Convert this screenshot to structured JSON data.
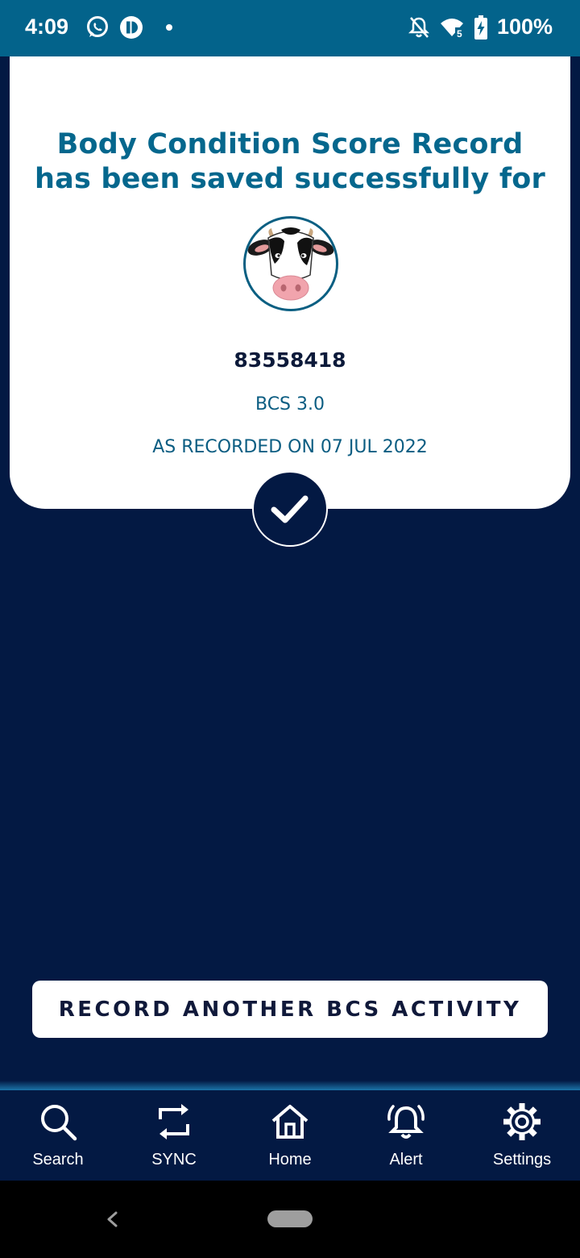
{
  "status_bar": {
    "time": "4:09",
    "battery": "100%",
    "icons": [
      "whatsapp-icon",
      "app-notification-icon",
      "notification-dot",
      "bell-off-icon",
      "wifi-icon",
      "battery-charging-icon"
    ]
  },
  "confirmation": {
    "title_line1": "Body Condition Score Record",
    "title_line2": "has been saved successfully for",
    "animal_id": "83558418",
    "score": "BCS 3.0",
    "recorded_on": "AS RECORDED ON 07 JUL 2022",
    "icon": "checkmark-icon"
  },
  "actions": {
    "record_another_label": "RECORD ANOTHER BCS ACTIVITY"
  },
  "bottom_nav": {
    "items": [
      {
        "label": "Search",
        "icon": "search-icon"
      },
      {
        "label": "SYNC",
        "icon": "sync-icon"
      },
      {
        "label": "Home",
        "icon": "home-icon"
      },
      {
        "label": "Alert",
        "icon": "bell-icon"
      },
      {
        "label": "Settings",
        "icon": "gear-icon"
      }
    ]
  },
  "colors": {
    "status_bar": "#03638b",
    "background": "#031943",
    "title": "#05678d",
    "card": "#ffffff"
  }
}
